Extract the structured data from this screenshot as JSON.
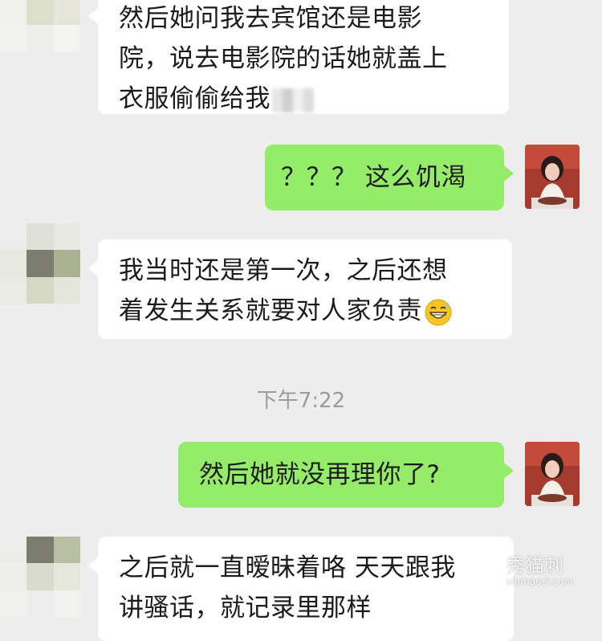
{
  "timestamp": "下午7:22",
  "messages": [
    {
      "side": "left",
      "lines": [
        "然后她问我去宾馆还是电影",
        "院，说去电影院的话她就盖上",
        "衣服偷偷给我"
      ]
    },
    {
      "side": "right",
      "text": "？？？ 这么饥渴"
    },
    {
      "side": "left",
      "lines": [
        "我当时还是第一次，之后还想",
        "着发生关系就要对人家负责"
      ],
      "emoji": "grinning-sweat-emoji"
    },
    {
      "side": "right",
      "text": "然后她就没再理你了?"
    },
    {
      "side": "left",
      "lines": [
        "之后就一直暧昧着咯 天天跟我",
        "讲骚话，就记录里那样"
      ]
    }
  ],
  "watermark": {
    "text": "秀猫刺",
    "sub": "xiumaoci.com"
  },
  "colors": {
    "background": "#ededed",
    "left_bubble": "#ffffff",
    "right_bubble": "#95ec69",
    "timestamp": "#9b9b9b"
  }
}
